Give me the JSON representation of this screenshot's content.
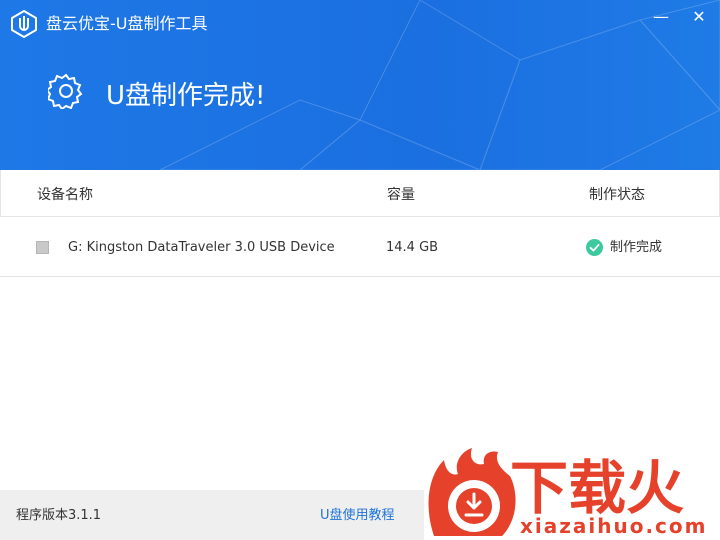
{
  "window": {
    "title": "盘云优宝-U盘制作工具",
    "minimize_label": "—",
    "close_label": "✕"
  },
  "banner": {
    "status_title": "U盘制作完成!",
    "icon": "gear-icon"
  },
  "table": {
    "columns": [
      "设备名称",
      "容量",
      "制作状态"
    ],
    "rows": [
      {
        "checked": false,
        "device_name": "G: Kingston DataTraveler 3.0 USB Device",
        "capacity": "14.4 GB",
        "status": "制作完成",
        "status_icon": "check-circle-icon",
        "status_color": "#3cc9a0"
      }
    ]
  },
  "footer": {
    "version": "程序版本3.1.1",
    "tutorial_link": "U盘使用教程"
  },
  "watermark": {
    "brand_cn": "下载火",
    "brand_en": "xiazaihuo.com",
    "color": "#e5412b"
  },
  "colors": {
    "header_blue": "#1b6fe0",
    "link_blue": "#1e73d8",
    "success_green": "#3cc9a0"
  }
}
